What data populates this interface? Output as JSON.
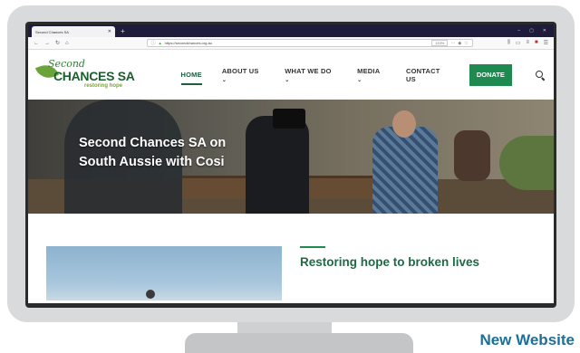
{
  "browser": {
    "tab_title": "Second Chances SA",
    "tab_close": "✕",
    "new_tab": "+",
    "url": "https://secondchances.org.au",
    "zoom": "133%",
    "window_min": "–",
    "window_max": "▢",
    "window_close": "✕"
  },
  "site": {
    "logo": {
      "script": "Second",
      "main": "CHANCES SA",
      "tagline": "restoring hope"
    },
    "nav": [
      {
        "label": "HOME",
        "caret": "",
        "active": true
      },
      {
        "label": "ABOUT US",
        "caret": "⌄"
      },
      {
        "label": "WHAT WE DO",
        "caret": "⌄"
      },
      {
        "label": "MEDIA",
        "caret": "⌄"
      },
      {
        "label": "CONTACT US",
        "caret": ""
      }
    ],
    "donate_label": "DONATE",
    "hero_title": "Second Chances SA on South Aussie with Cosi",
    "section_heading": "Restoring hope to broken lives"
  },
  "caption": "New Website",
  "colors": {
    "accent_green": "#1e8a4f",
    "caption_blue": "#1b6f98",
    "browser_tabbar": "#1f1b3a"
  }
}
